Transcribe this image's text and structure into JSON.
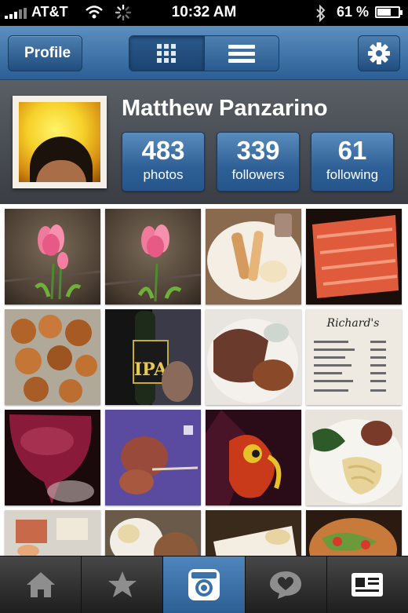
{
  "status_bar": {
    "carrier": "AT&T",
    "time": "10:32 AM",
    "battery_percent": "61 %"
  },
  "nav": {
    "back_label": "Profile",
    "segments": [
      "grid-icon",
      "list-icon"
    ],
    "settings_icon": "gear-icon"
  },
  "profile": {
    "name": "Matthew Panzarino",
    "stats": [
      {
        "value": "483",
        "label": "photos"
      },
      {
        "value": "339",
        "label": "followers"
      },
      {
        "value": "61",
        "label": "following"
      }
    ]
  },
  "photos": [
    {
      "subject": "pink tulips"
    },
    {
      "subject": "pink tulips"
    },
    {
      "subject": "plate of food"
    },
    {
      "subject": "raw salmon"
    },
    {
      "subject": "fried food"
    },
    {
      "subject": "beer bottle"
    },
    {
      "subject": "meat plate"
    },
    {
      "subject": "dinner menu"
    },
    {
      "subject": "red wine glass"
    },
    {
      "subject": "skewered meat"
    },
    {
      "subject": "colorful art"
    },
    {
      "subject": "pasta dish"
    },
    {
      "subject": "food table"
    },
    {
      "subject": "dessert plate"
    },
    {
      "subject": "plated dish"
    },
    {
      "subject": "salad bowl"
    }
  ],
  "menu_text": {
    "title": "Richard's"
  },
  "beer_label": "IPA",
  "tabs": [
    {
      "icon": "home-icon"
    },
    {
      "icon": "star-icon"
    },
    {
      "icon": "camera-icon"
    },
    {
      "icon": "heart-bubble-icon"
    },
    {
      "icon": "profile-card-icon"
    }
  ],
  "colors": {
    "nav_blue": "#2b5f95",
    "stat_blue": "#2e6097",
    "header_gray": "#4a4e54",
    "active_tab": "#3c72a9"
  }
}
